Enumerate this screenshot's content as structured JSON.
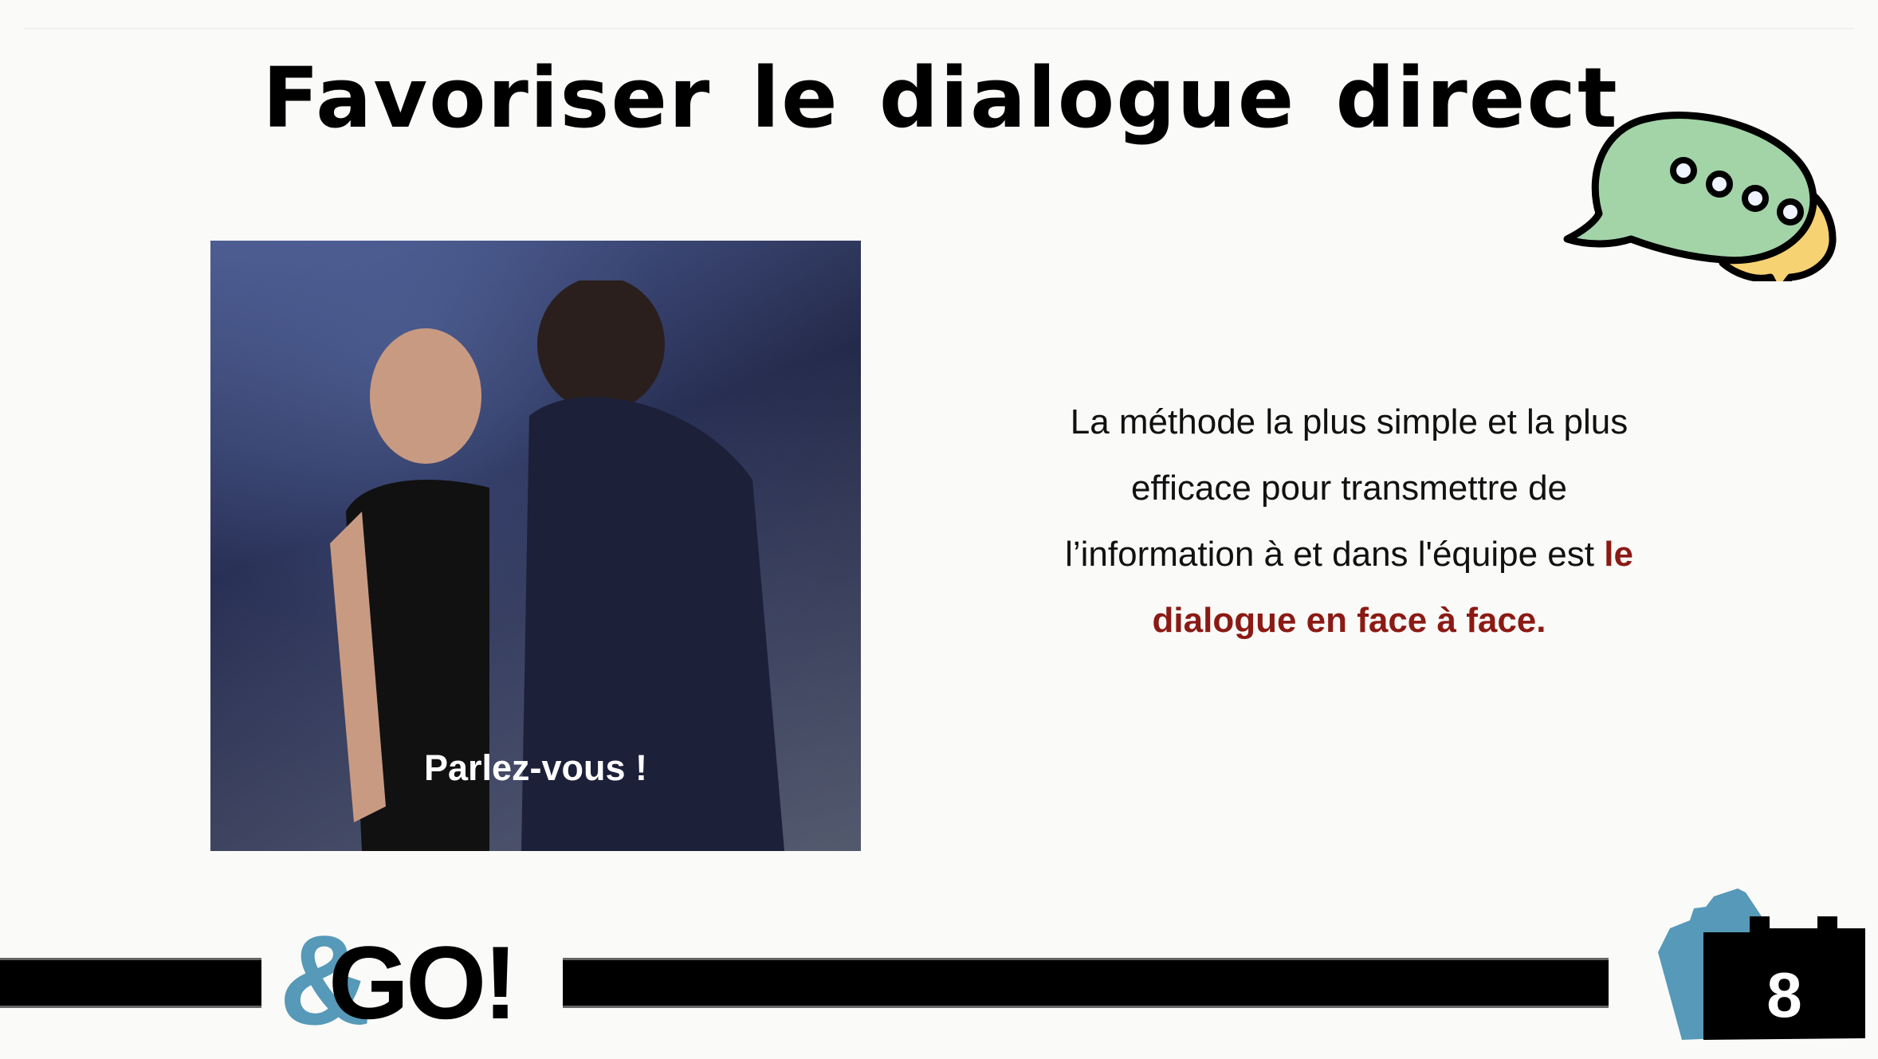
{
  "slide": {
    "title": "Favoriser le dialogue direct",
    "image_caption": "Parlez-vous !",
    "body_text": "La méthode la plus simple et la plus efficace pour transmettre de l’information à et dans l'équipe est ",
    "body_highlight": "le dialogue en face à face.",
    "highlight_color": "#8b1a14",
    "logo_text": "&GO!",
    "page_number": "8",
    "icons": [
      "speech-bubbles-icon",
      "puzzle-block-icon"
    ]
  }
}
